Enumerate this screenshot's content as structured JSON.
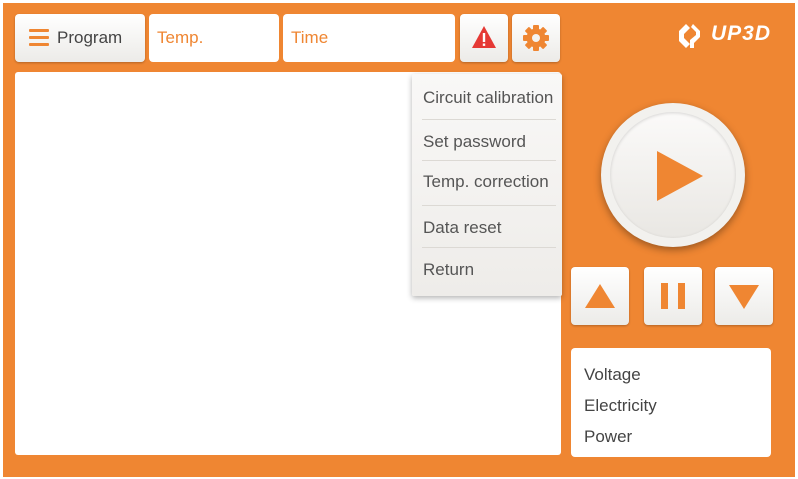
{
  "header": {
    "program_label": "Program",
    "temp_placeholder": "Temp.",
    "time_placeholder": "Time",
    "logo_text": "UP3D"
  },
  "settings_menu": {
    "items": [
      {
        "label": "Circuit calibration"
      },
      {
        "label": "Set password"
      },
      {
        "label": "Temp. correction"
      },
      {
        "label": "Data reset"
      },
      {
        "label": "Return"
      }
    ]
  },
  "controls": {
    "play_icon": "play-icon",
    "up_icon": "triangle-up-icon",
    "pause_icon": "pause-icon",
    "down_icon": "triangle-down-icon"
  },
  "info_panel": {
    "voltage_label": "Voltage",
    "electricity_label": "Electricity",
    "power_label": "Power"
  },
  "colors": {
    "accent": "#ef8632",
    "warning": "#e53935",
    "panel": "#ffffff"
  }
}
